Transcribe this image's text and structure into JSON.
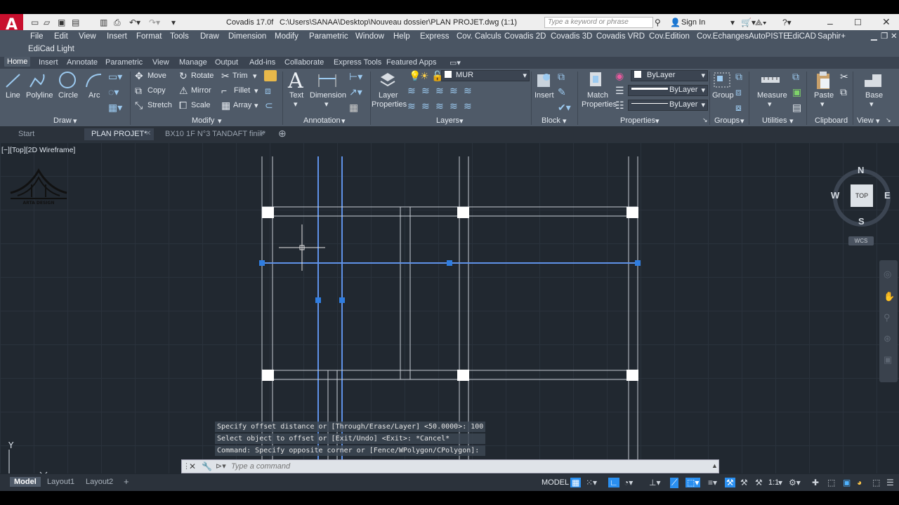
{
  "titlebar": {
    "app_name": "Covadis 17.0f",
    "file_path": "C:\\Users\\SANAA\\Desktop\\Nouveau dossier\\PLAN PROJET.dwg (1:1)",
    "search_placeholder": "Type a keyword or phrase",
    "sign_in": "Sign In"
  },
  "menu": {
    "items": [
      "File",
      "Edit",
      "View",
      "Insert",
      "Format",
      "Tools",
      "Draw",
      "Dimension",
      "Modify",
      "Parametric",
      "Window",
      "Help",
      "Express",
      "Cov. Calculs",
      "Covadis 2D",
      "Covadis 3D",
      "Covadis VRD",
      "Cov.Edition",
      "Cov.Echanges",
      "AutoPISTE",
      "EdiCAD",
      "Saphir+"
    ],
    "second_row": "EdiCad Light"
  },
  "ribbon_tabs": [
    "Home",
    "Insert",
    "Annotate",
    "Parametric",
    "View",
    "Manage",
    "Output",
    "Add-ins",
    "Collaborate",
    "Express Tools",
    "Featured Apps"
  ],
  "draw": {
    "line": "Line",
    "polyline": "Polyline",
    "circle": "Circle",
    "arc": "Arc",
    "footer": "Draw"
  },
  "modify": {
    "move": "Move",
    "rotate": "Rotate",
    "trim": "Trim",
    "copy": "Copy",
    "mirror": "Mirror",
    "fillet": "Fillet",
    "stretch": "Stretch",
    "scale": "Scale",
    "array": "Array",
    "footer": "Modify"
  },
  "annotation": {
    "text": "Text",
    "dimension": "Dimension",
    "footer": "Annotation"
  },
  "layers": {
    "layer_properties_1": "Layer",
    "layer_properties_2": "Properties",
    "current_layer": "MUR",
    "footer": "Layers"
  },
  "block": {
    "insert": "Insert",
    "footer": "Block"
  },
  "properties": {
    "match_1": "Match",
    "match_2": "Properties",
    "color": "ByLayer",
    "linetype": "ByLayer",
    "lineweight": "ByLayer",
    "footer": "Properties"
  },
  "groups": {
    "group": "Group",
    "footer": "Groups"
  },
  "utilities": {
    "measure": "Measure",
    "footer": "Utilities"
  },
  "clipboard": {
    "paste": "Paste",
    "footer": "Clipboard"
  },
  "view_panel": {
    "base": "Base",
    "footer": "View"
  },
  "doc_tabs": [
    "Start",
    "PLAN PROJET*",
    "BX10 1F N°3 TANDAFT finiii*"
  ],
  "viewport": {
    "label": "[−][Top][2D Wireframe]",
    "compass": {
      "n": "N",
      "s": "S",
      "e": "E",
      "w": "W",
      "top": "TOP",
      "ucs": "WCS"
    },
    "ucs_y": "Y",
    "logo_text": "ARTA DESIGN"
  },
  "command_history": [
    "Specify offset distance or [Through/Erase/Layer] <50.0000>: 100",
    "Select object to offset or [Exit/Undo] <Exit>: *Cancel*",
    "Command: Specify opposite corner or [Fence/WPolygon/CPolygon]:"
  ],
  "command_placeholder": "Type a command",
  "layout_tabs": [
    "Model",
    "Layout1",
    "Layout2"
  ],
  "status": {
    "model": "MODEL",
    "scale": "1:1"
  },
  "colors": {
    "accent": "#2a8ff0",
    "selected_line": "#5f92e8",
    "grip": "#2f7de0",
    "canvas": "#212830",
    "ribbon": "#4f5a68"
  }
}
